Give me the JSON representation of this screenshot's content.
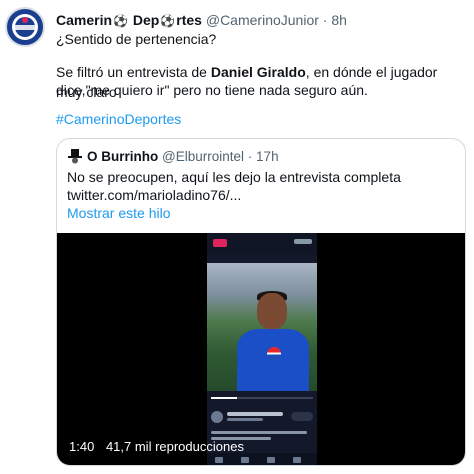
{
  "tweet": {
    "author_name": "Camerin",
    "author_name_mid": "Dep",
    "author_name_end": "rtes",
    "ball_emoji": "⚽",
    "handle": "@CamerinoJunior",
    "separator": "·",
    "time": "8h",
    "line1": "¿Sentido de pertenencia?",
    "line2_a": "Se filtró un entrevista de ",
    "line2_bold": "Daniel Giraldo",
    "line2_b": ", en dónde el jugador muy claro",
    "line3": "dice,\"me quiero ir\" pero no tiene nada seguro aún.",
    "hashtag": "#CamerinoDeportes"
  },
  "quote": {
    "author_name": "O Burrinho",
    "handle": "@Elburrointel",
    "separator": "·",
    "time": "17h",
    "text_line1": "No se preocupen, aquí les dejo la entrevista completa",
    "text_line2": "twitter.com/marioladino76/...",
    "show_thread": "Mostrar este hilo"
  },
  "video": {
    "duration": "1:40",
    "views": "41,7 mil reproducciones",
    "progress_fraction": 0.25
  },
  "colors": {
    "link": "#1d9bf0",
    "text": "#0f1419",
    "muted": "#536471",
    "border": "#cfd9de"
  },
  "icons": {
    "avatar": "team-logo-avatar",
    "quote_avatar": "tophat-avatar"
  }
}
